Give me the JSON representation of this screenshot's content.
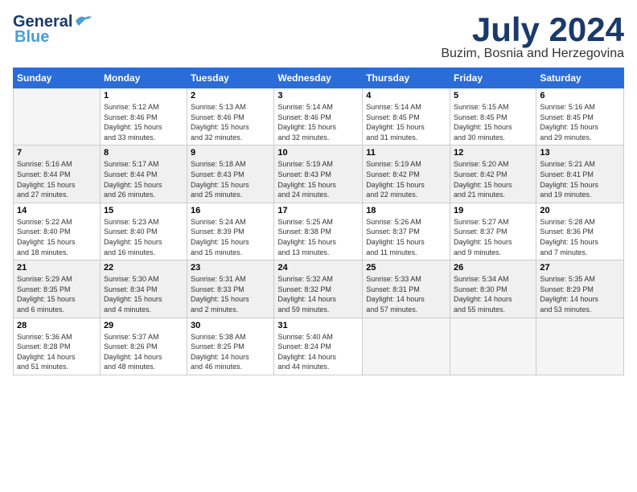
{
  "logo": {
    "line1": "General",
    "line2": "Blue",
    "bird_symbol": "▲"
  },
  "title": {
    "month_year": "July 2024",
    "location": "Buzim, Bosnia and Herzegovina"
  },
  "weekdays": [
    "Sunday",
    "Monday",
    "Tuesday",
    "Wednesday",
    "Thursday",
    "Friday",
    "Saturday"
  ],
  "weeks": [
    [
      {
        "day": "",
        "info": ""
      },
      {
        "day": "1",
        "info": "Sunrise: 5:12 AM\nSunset: 8:46 PM\nDaylight: 15 hours\nand 33 minutes."
      },
      {
        "day": "2",
        "info": "Sunrise: 5:13 AM\nSunset: 8:46 PM\nDaylight: 15 hours\nand 32 minutes."
      },
      {
        "day": "3",
        "info": "Sunrise: 5:14 AM\nSunset: 8:46 PM\nDaylight: 15 hours\nand 32 minutes."
      },
      {
        "day": "4",
        "info": "Sunrise: 5:14 AM\nSunset: 8:45 PM\nDaylight: 15 hours\nand 31 minutes."
      },
      {
        "day": "5",
        "info": "Sunrise: 5:15 AM\nSunset: 8:45 PM\nDaylight: 15 hours\nand 30 minutes."
      },
      {
        "day": "6",
        "info": "Sunrise: 5:16 AM\nSunset: 8:45 PM\nDaylight: 15 hours\nand 29 minutes."
      }
    ],
    [
      {
        "day": "7",
        "info": "Sunrise: 5:16 AM\nSunset: 8:44 PM\nDaylight: 15 hours\nand 27 minutes."
      },
      {
        "day": "8",
        "info": "Sunrise: 5:17 AM\nSunset: 8:44 PM\nDaylight: 15 hours\nand 26 minutes."
      },
      {
        "day": "9",
        "info": "Sunrise: 5:18 AM\nSunset: 8:43 PM\nDaylight: 15 hours\nand 25 minutes."
      },
      {
        "day": "10",
        "info": "Sunrise: 5:19 AM\nSunset: 8:43 PM\nDaylight: 15 hours\nand 24 minutes."
      },
      {
        "day": "11",
        "info": "Sunrise: 5:19 AM\nSunset: 8:42 PM\nDaylight: 15 hours\nand 22 minutes."
      },
      {
        "day": "12",
        "info": "Sunrise: 5:20 AM\nSunset: 8:42 PM\nDaylight: 15 hours\nand 21 minutes."
      },
      {
        "day": "13",
        "info": "Sunrise: 5:21 AM\nSunset: 8:41 PM\nDaylight: 15 hours\nand 19 minutes."
      }
    ],
    [
      {
        "day": "14",
        "info": "Sunrise: 5:22 AM\nSunset: 8:40 PM\nDaylight: 15 hours\nand 18 minutes."
      },
      {
        "day": "15",
        "info": "Sunrise: 5:23 AM\nSunset: 8:40 PM\nDaylight: 15 hours\nand 16 minutes."
      },
      {
        "day": "16",
        "info": "Sunrise: 5:24 AM\nSunset: 8:39 PM\nDaylight: 15 hours\nand 15 minutes."
      },
      {
        "day": "17",
        "info": "Sunrise: 5:25 AM\nSunset: 8:38 PM\nDaylight: 15 hours\nand 13 minutes."
      },
      {
        "day": "18",
        "info": "Sunrise: 5:26 AM\nSunset: 8:37 PM\nDaylight: 15 hours\nand 11 minutes."
      },
      {
        "day": "19",
        "info": "Sunrise: 5:27 AM\nSunset: 8:37 PM\nDaylight: 15 hours\nand 9 minutes."
      },
      {
        "day": "20",
        "info": "Sunrise: 5:28 AM\nSunset: 8:36 PM\nDaylight: 15 hours\nand 7 minutes."
      }
    ],
    [
      {
        "day": "21",
        "info": "Sunrise: 5:29 AM\nSunset: 8:35 PM\nDaylight: 15 hours\nand 6 minutes."
      },
      {
        "day": "22",
        "info": "Sunrise: 5:30 AM\nSunset: 8:34 PM\nDaylight: 15 hours\nand 4 minutes."
      },
      {
        "day": "23",
        "info": "Sunrise: 5:31 AM\nSunset: 8:33 PM\nDaylight: 15 hours\nand 2 minutes."
      },
      {
        "day": "24",
        "info": "Sunrise: 5:32 AM\nSunset: 8:32 PM\nDaylight: 14 hours\nand 59 minutes."
      },
      {
        "day": "25",
        "info": "Sunrise: 5:33 AM\nSunset: 8:31 PM\nDaylight: 14 hours\nand 57 minutes."
      },
      {
        "day": "26",
        "info": "Sunrise: 5:34 AM\nSunset: 8:30 PM\nDaylight: 14 hours\nand 55 minutes."
      },
      {
        "day": "27",
        "info": "Sunrise: 5:35 AM\nSunset: 8:29 PM\nDaylight: 14 hours\nand 53 minutes."
      }
    ],
    [
      {
        "day": "28",
        "info": "Sunrise: 5:36 AM\nSunset: 8:28 PM\nDaylight: 14 hours\nand 51 minutes."
      },
      {
        "day": "29",
        "info": "Sunrise: 5:37 AM\nSunset: 8:26 PM\nDaylight: 14 hours\nand 48 minutes."
      },
      {
        "day": "30",
        "info": "Sunrise: 5:38 AM\nSunset: 8:25 PM\nDaylight: 14 hours\nand 46 minutes."
      },
      {
        "day": "31",
        "info": "Sunrise: 5:40 AM\nSunset: 8:24 PM\nDaylight: 14 hours\nand 44 minutes."
      },
      {
        "day": "",
        "info": ""
      },
      {
        "day": "",
        "info": ""
      },
      {
        "day": "",
        "info": ""
      }
    ]
  ]
}
